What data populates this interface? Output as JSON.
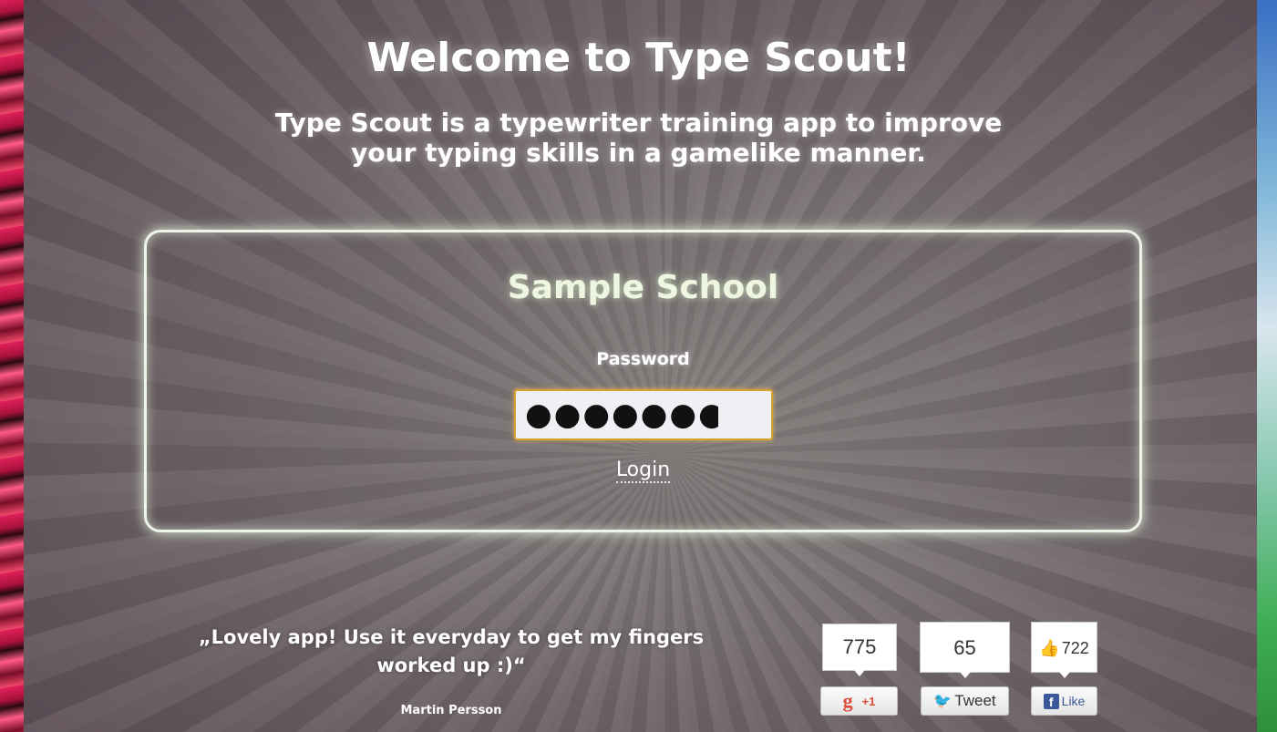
{
  "header": {
    "title": "Welcome to Type Scout!",
    "subtitle_line1": "Type Scout is a typewriter training app to improve",
    "subtitle_line2": "your typing skills in a gamelike manner."
  },
  "login": {
    "school_name": "Sample School",
    "password_label": "Password",
    "password_value": "●●●●●●●",
    "login_label": "Login"
  },
  "testimonial": {
    "quote_line1": "„Lovely app! Use it everyday to get my fingers",
    "quote_line2": "worked up :)“",
    "author": "Martin Persson"
  },
  "social": {
    "gplus": {
      "count": "775",
      "label": "+1",
      "icon": "g-icon"
    },
    "twitter": {
      "count": "65",
      "label": "Tweet",
      "icon": "twitter-bird-icon"
    },
    "facebook": {
      "count": "722",
      "label": "Like",
      "icon": "facebook-f-icon"
    }
  },
  "colors": {
    "accent_border": "#eef4e8",
    "input_border": "#d8a030",
    "facebook_blue": "#3b5998",
    "twitter_blue": "#1d9bf0",
    "gplus_red": "#dd4b39"
  }
}
